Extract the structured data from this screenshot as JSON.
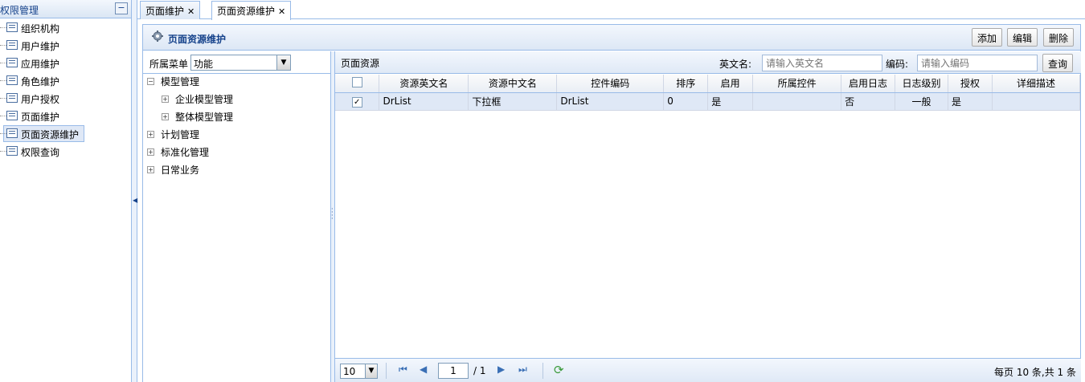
{
  "left_nav": {
    "title": "权限管理",
    "collapse_glyph": "−",
    "items": [
      {
        "label": "组织机构",
        "icon": "list-icon"
      },
      {
        "label": "用户维护",
        "icon": "list-icon"
      },
      {
        "label": "应用维护",
        "icon": "list-icon"
      },
      {
        "label": "角色维护",
        "icon": "list-icon"
      },
      {
        "label": "用户授权",
        "icon": "list-icon"
      },
      {
        "label": "页面维护",
        "icon": "list-icon"
      },
      {
        "label": "页面资源维护",
        "icon": "list-icon",
        "selected": true
      },
      {
        "label": "权限查询",
        "icon": "list-icon"
      }
    ]
  },
  "tabs": [
    {
      "label": "页面维护",
      "close": "✕"
    },
    {
      "label": "页面资源维护",
      "close": "✕",
      "active": true
    }
  ],
  "main": {
    "title": "页面资源维护",
    "toolbar": {
      "add_label": "添加",
      "edit_label": "编辑",
      "delete_label": "删除"
    }
  },
  "tree": {
    "filter_label": "所属菜单",
    "select_value": "功能",
    "nodes": [
      {
        "label": "模型管理",
        "expanded": true,
        "level": 0
      },
      {
        "label": "企业模型管理",
        "level": 1
      },
      {
        "label": "整体模型管理",
        "level": 1
      },
      {
        "label": "计划管理",
        "level": 0
      },
      {
        "label": "标准化管理",
        "level": 0
      },
      {
        "label": "日常业务",
        "level": 0
      }
    ]
  },
  "grid": {
    "title": "页面资源",
    "search": {
      "en_label": "英文名:",
      "en_placeholder": "请输入英文名",
      "code_label": "编码:",
      "code_placeholder": "请输入编码",
      "query_label": "查询"
    },
    "columns": [
      "资源英文名",
      "资源中文名",
      "控件编码",
      "排序",
      "启用",
      "所属控件",
      "启用日志",
      "日志级别",
      "授权",
      "详细描述"
    ],
    "rows": [
      {
        "checked": true,
        "cells": [
          "DrList",
          "下拉框",
          "DrList",
          "0",
          "是",
          "",
          "否",
          "一般",
          "是",
          ""
        ]
      }
    ]
  },
  "pager": {
    "page_size": "10",
    "current_page": "1",
    "total_pages": "/ 1",
    "info": "每页 10 条,共 1 条"
  },
  "colors": {
    "header_text": "#15428b",
    "border": "#99bbe8",
    "selected_row": "#dfe8f6"
  }
}
